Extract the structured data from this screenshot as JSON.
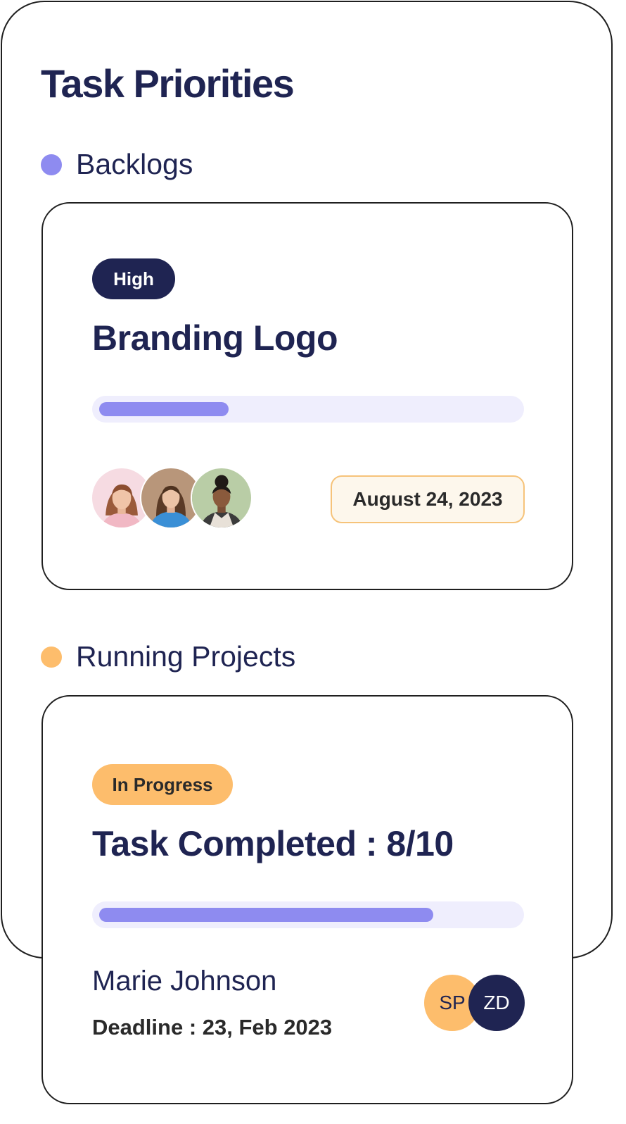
{
  "page": {
    "title": "Task Priorities"
  },
  "colors": {
    "navy": "#1f2452",
    "purple": "#8e8bf0",
    "orange": "#fdbd6c",
    "track": "#efeefd"
  },
  "backlogs": {
    "label": "Backlogs",
    "card": {
      "priority": "High",
      "title": "Branding Logo",
      "progress": 0.31,
      "assignees": [
        "team-member-1",
        "team-member-2",
        "team-member-3"
      ],
      "date": "August 24, 2023"
    }
  },
  "running": {
    "label": "Running Projects",
    "card": {
      "status": "In Progress",
      "title": "Task Completed : 8/10",
      "progress": 0.8,
      "person": "Marie Johnson",
      "deadline": "Deadline : 23, Feb 2023",
      "initials": [
        "SP",
        "ZD"
      ]
    }
  }
}
